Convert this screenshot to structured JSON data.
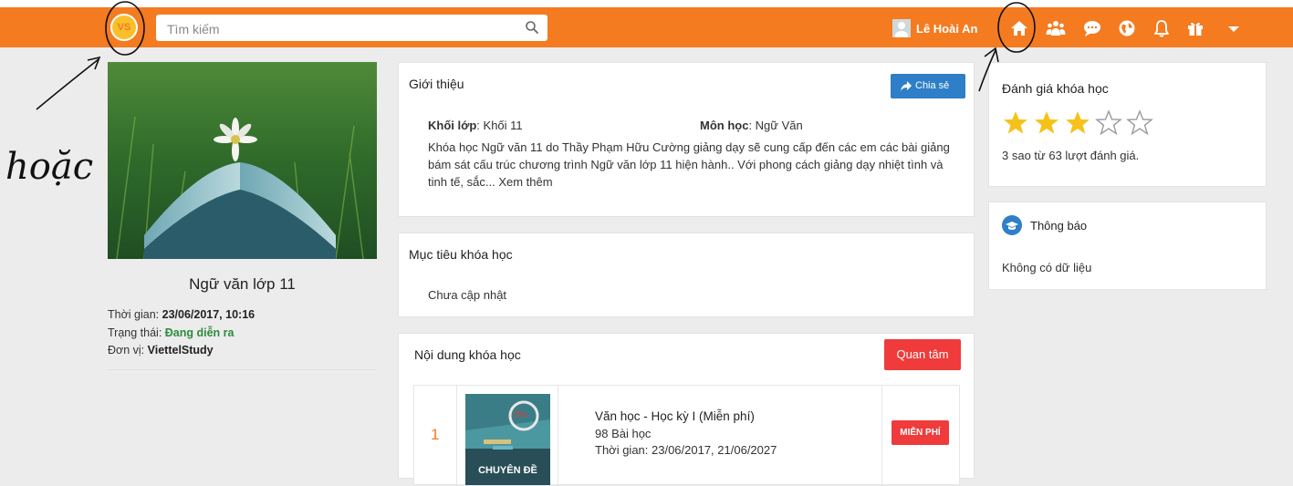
{
  "header": {
    "logo_text": "VS",
    "search_placeholder": "Tìm kiếm",
    "user_name": "Lê Hoài An",
    "nav_icons": [
      "home-icon",
      "users-icon",
      "chat-icon",
      "globe-icon",
      "bell-icon",
      "gift-icon",
      "caret-down-icon"
    ]
  },
  "annotation": {
    "handwriting": "hoặc"
  },
  "course": {
    "title": "Ngữ văn lớp 11",
    "time_label": "Thời gian: ",
    "time_value": "23/06/2017, 10:16",
    "status_label": "Trạng thái: ",
    "status_value": "Đang diễn ra",
    "unit_label": "Đơn vị: ",
    "unit_value": "ViettelStudy"
  },
  "intro": {
    "title": "Giới thiệu",
    "share_label": "Chia sẻ",
    "grade_label": "Khối lớp",
    "grade_value": ": Khối 11",
    "subject_label": "Môn học",
    "subject_value": ": Ngữ Văn",
    "description": "Khóa học Ngữ văn 11 do Thầy Phạm Hữu Cường giảng dạy sẽ cung cấp đến các em các bài giảng bám sát cấu trúc chương trình Ngữ văn lớp 11 hiện hành.. Với phong cách giảng dạy nhiệt tình và tinh tế, sắc... Xem thêm"
  },
  "goals": {
    "title": "Mục tiêu khóa học",
    "text": "Chưa cập nhật"
  },
  "content": {
    "title": "Nội dung khóa học",
    "follow_label": "Quan tâm",
    "items": [
      {
        "index": "1",
        "progress": "0%",
        "thumb_caption": "CHUYÊN ĐỀ",
        "name": "Văn học - Học kỳ I (Miễn phí)",
        "lessons": "98 Bài học",
        "time": "Thời gian: 23/06/2017, 21/06/2027",
        "badge": "MIỄN PHÍ"
      }
    ]
  },
  "rating": {
    "title": "Đánh giá khóa học",
    "stars_filled": 3,
    "stars_total": 5,
    "summary": "3 sao từ 63 lượt đánh giá."
  },
  "notice": {
    "title": "Thông báo",
    "empty_text": "Không có dữ liệu"
  },
  "colors": {
    "header": "#f47b20",
    "share_button": "#2e7fc7",
    "red_button": "#ef3b3b",
    "star": "#f6c21a",
    "status_green": "#2e8b3d"
  }
}
